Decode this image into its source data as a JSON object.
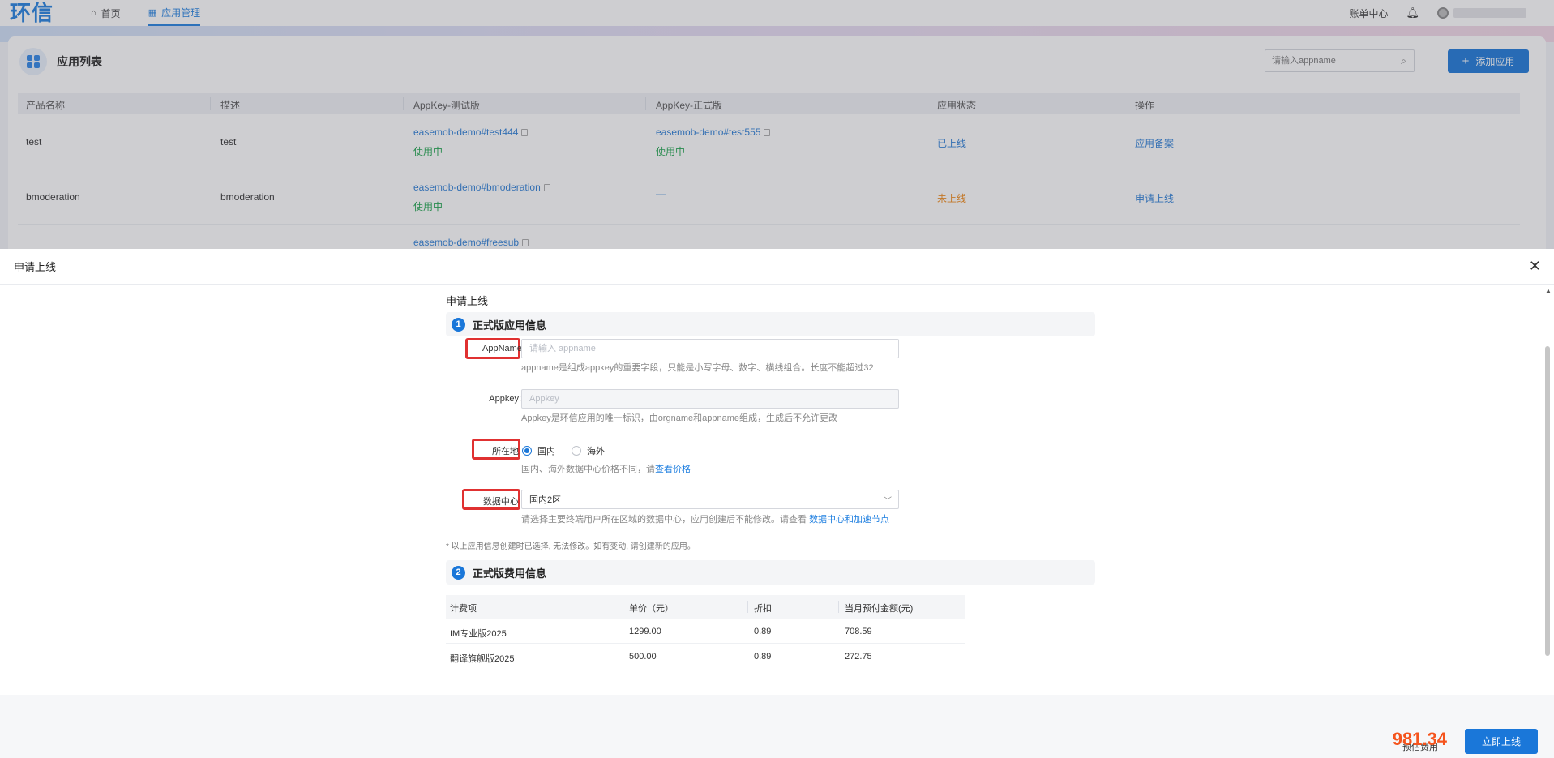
{
  "topbar": {
    "logo": "环信",
    "nav": [
      {
        "label": "首页",
        "icon": "home-icon"
      },
      {
        "label": "应用管理",
        "icon": "grid-icon",
        "active": true
      }
    ],
    "billing_label": "账单中心",
    "bell_icon": "bell-icon"
  },
  "app_list": {
    "title": "应用列表",
    "search_placeholder": "请输入appname",
    "add_button": "添加应用",
    "columns": [
      "产品名称",
      "描述",
      "AppKey-测试版",
      "AppKey-正式版",
      "应用状态",
      "操作"
    ],
    "rows": [
      {
        "name": "test",
        "desc": "test",
        "test_key": "easemob-demo#test444",
        "test_status": "使用中",
        "prod_key": "easemob-demo#test555",
        "prod_status": "使用中",
        "status": "已上线",
        "action": "应用备案"
      },
      {
        "name": "bmoderation",
        "desc": "bmoderation",
        "test_key": "easemob-demo#bmoderation",
        "test_status": "使用中",
        "prod_key": "—",
        "prod_status": "",
        "status": "未上线",
        "action": "申请上线"
      },
      {
        "name": "",
        "desc": "",
        "test_key": "easemob-demo#freesub",
        "test_status": "",
        "prod_key": "",
        "prod_status": "",
        "status": "",
        "action": ""
      }
    ]
  },
  "drawer": {
    "title": "申请上线",
    "section_label": "申请上线",
    "step1": {
      "num": "1",
      "title": "正式版应用信息"
    },
    "fields": {
      "appname_label": "AppName:",
      "appname_placeholder": "请输入 appname",
      "appname_hint": "appname是组成appkey的重要字段，只能是小写字母、数字、横线组合。长度不能超过32",
      "appkey_label": "Appkey:",
      "appkey_placeholder": "Appkey",
      "appkey_hint": "Appkey是环信应用的唯一标识，由orgname和appname组成，生成后不允许更改",
      "location_label": "所在地:",
      "location_options": [
        "国内",
        "海外"
      ],
      "location_selected": "国内",
      "location_hint": "国内、海外数据中心价格不同，请",
      "location_hint_link": "查看价格",
      "datacenter_label": "数据中心:",
      "datacenter_value": "国内2区",
      "datacenter_hint": "请选择主要终端用户所在区域的数据中心，应用创建后不能修改。请查看",
      "datacenter_hint_link": "数据中心和加速节点"
    },
    "note": "*  以上应用信息创建时已选择, 无法修改。如有变动, 请创建新的应用。",
    "step2": {
      "num": "2",
      "title": "正式版费用信息"
    },
    "fee_columns": [
      "计费项",
      "单价（元）",
      "折扣",
      "当月预付金额(元)"
    ],
    "fee_rows": [
      [
        "IM专业版2025",
        "1299.00",
        "0.89",
        "708.59"
      ],
      [
        "翻译旗舰版2025",
        "500.00",
        "0.89",
        "272.75"
      ]
    ]
  },
  "footer": {
    "estimate_label": "预估费用",
    "estimate_value": "981.34",
    "submit": "立即上线"
  },
  "colors": {
    "primary": "#1a77d9",
    "highlight_box": "#e03131",
    "price": "#f5541d",
    "online_green": "#1aa34a",
    "offline_orange": "#f08a1a"
  }
}
